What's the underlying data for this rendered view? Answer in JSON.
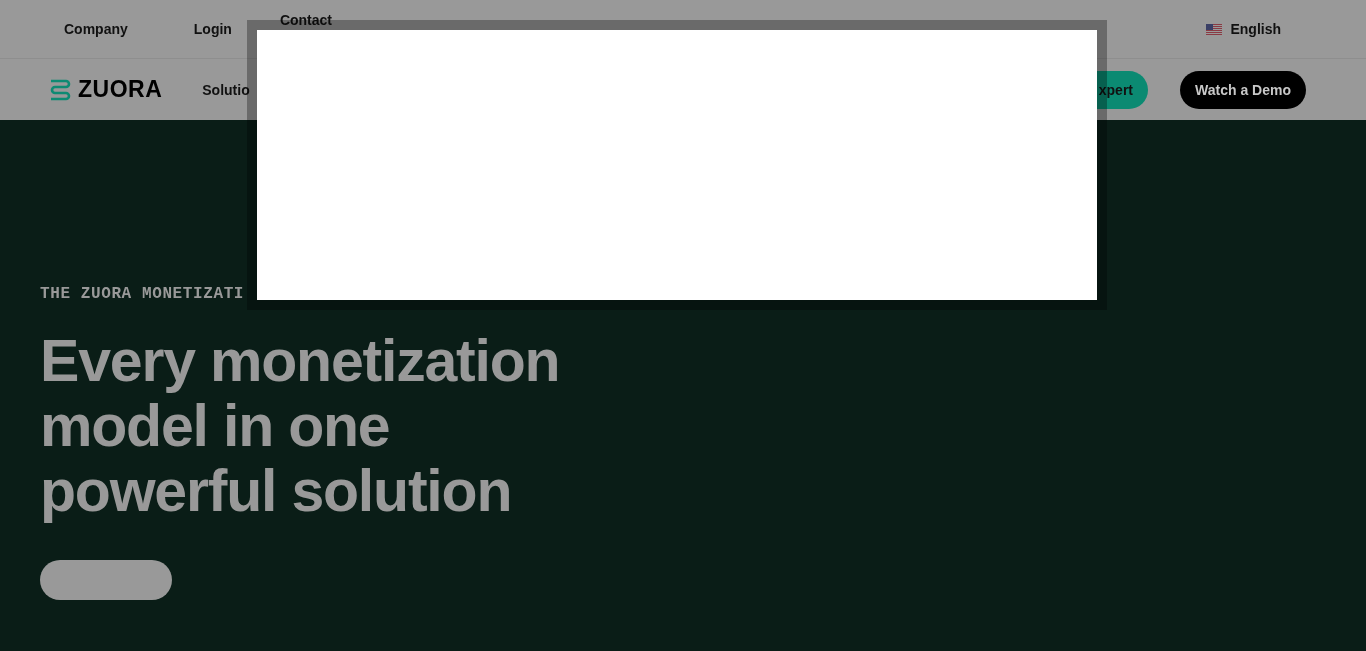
{
  "top_bar": {
    "links": [
      {
        "label": "Company"
      },
      {
        "label": "Login"
      },
      {
        "label": "Contact"
      }
    ],
    "language": "English"
  },
  "nav": {
    "logo": "ZUORA",
    "items": [
      {
        "label": "Solutio"
      }
    ],
    "buttons": [
      {
        "label": "xpert",
        "kind": "primary"
      },
      {
        "label": "Watch a Demo",
        "kind": "dark"
      }
    ]
  },
  "hero": {
    "eyebrow": "THE ZUORA MONETIZATI",
    "title_lines": [
      "Every monetization",
      "model in one",
      "powerful solution"
    ],
    "button": {
      "kind": "blank"
    }
  }
}
